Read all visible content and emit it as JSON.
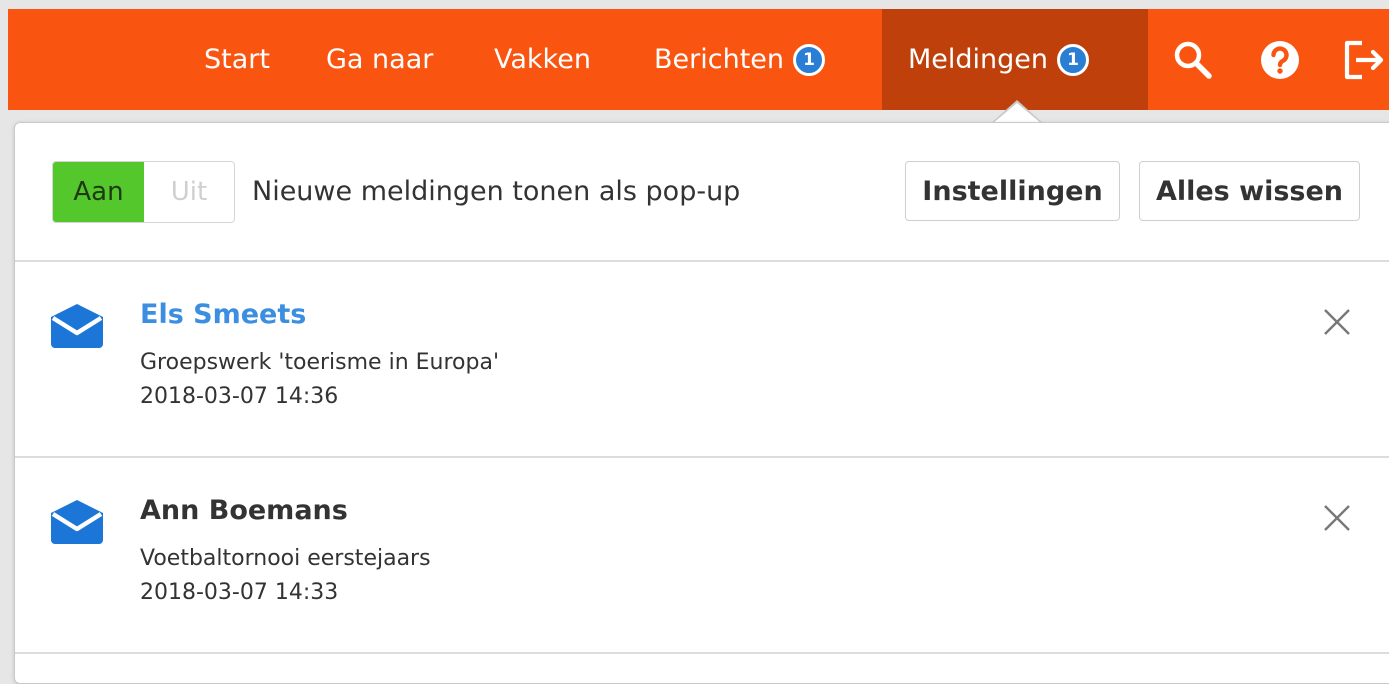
{
  "nav": {
    "items": [
      {
        "label": "Start"
      },
      {
        "label": "Ga naar"
      },
      {
        "label": "Vakken"
      },
      {
        "label": "Berichten",
        "badge": "1"
      },
      {
        "label": "Meldingen",
        "badge": "1",
        "active": true
      }
    ],
    "icons": [
      "search-icon",
      "help-icon",
      "logout-icon"
    ]
  },
  "panel": {
    "toggle": {
      "on_label": "Aan",
      "off_label": "Uit",
      "state": "on"
    },
    "popup_label": "Nieuwe meldingen tonen als pop-up",
    "settings_button": "Instellingen",
    "clear_all_button": "Alles wissen",
    "notifications": [
      {
        "sender": "Els Smeets",
        "subject": "Groepswerk 'toerisme in Europa'",
        "time": "2018-03-07 14:36",
        "unread": true
      },
      {
        "sender": "Ann Boemans",
        "subject": "Voetbaltornooi eerstejaars",
        "time": "2018-03-07 14:33",
        "unread": false
      }
    ]
  },
  "colors": {
    "brand": "#f95510",
    "nav_active": "#c0400b",
    "badge": "#2a7fd4",
    "toggle_on": "#53c72b",
    "unread_sender": "#3b8ee0",
    "mail_icon": "#1b76d8"
  }
}
